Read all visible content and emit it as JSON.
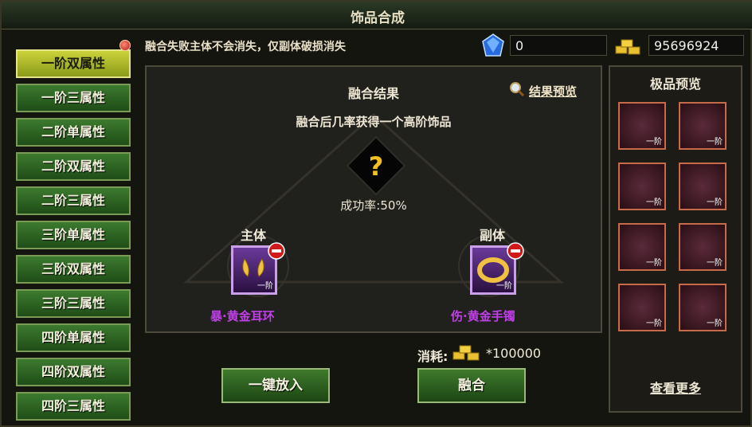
{
  "window": {
    "title": "饰品合成"
  },
  "sidebar": {
    "items": [
      {
        "label": "一阶双属性",
        "active": true
      },
      {
        "label": "一阶三属性"
      },
      {
        "label": "二阶单属性"
      },
      {
        "label": "二阶双属性"
      },
      {
        "label": "二阶三属性"
      },
      {
        "label": "三阶单属性"
      },
      {
        "label": "三阶双属性"
      },
      {
        "label": "三阶三属性"
      },
      {
        "label": "四阶单属性"
      },
      {
        "label": "四阶双属性"
      },
      {
        "label": "四阶三属性"
      }
    ]
  },
  "info": {
    "notice": "融合失败主体不会消失，仅副体破损消失"
  },
  "currency": {
    "gem": "0",
    "gold": "95696924"
  },
  "main": {
    "title": "融合结果",
    "preview_link": "结果预览",
    "description": "融合后几率获得一个高阶饰品",
    "result_symbol": "?",
    "success_rate": "成功率:50%",
    "primary": {
      "label": "主体",
      "item_name": "暴·黄金耳环",
      "tier": "一阶"
    },
    "secondary": {
      "label": "副体",
      "item_name": "伤·黄金手镯",
      "tier": "一阶"
    }
  },
  "cost": {
    "label": "消耗:",
    "value": "*100000"
  },
  "buttons": {
    "auto_fill": "一键放入",
    "fuse": "融合"
  },
  "right_panel": {
    "title": "极品预览",
    "items": [
      {
        "icon": "earring-icon",
        "tier": "一阶"
      },
      {
        "icon": "mask-icon",
        "tier": "一阶"
      },
      {
        "icon": "bracelet-icon",
        "tier": "一阶"
      },
      {
        "icon": "winged-gem-icon",
        "tier": "一阶"
      },
      {
        "icon": "bow-icon",
        "tier": "一阶"
      },
      {
        "icon": "ribbon-icon",
        "tier": "一阶"
      },
      {
        "icon": "shield-badge-icon",
        "tier": "一阶"
      },
      {
        "icon": "face-mask-icon",
        "tier": "一阶"
      }
    ],
    "more_link": "查看更多"
  },
  "colors": {
    "accent_green": "#3e7a2c",
    "active_yellow": "#cbd23a",
    "item_purple": "#c040e8"
  }
}
